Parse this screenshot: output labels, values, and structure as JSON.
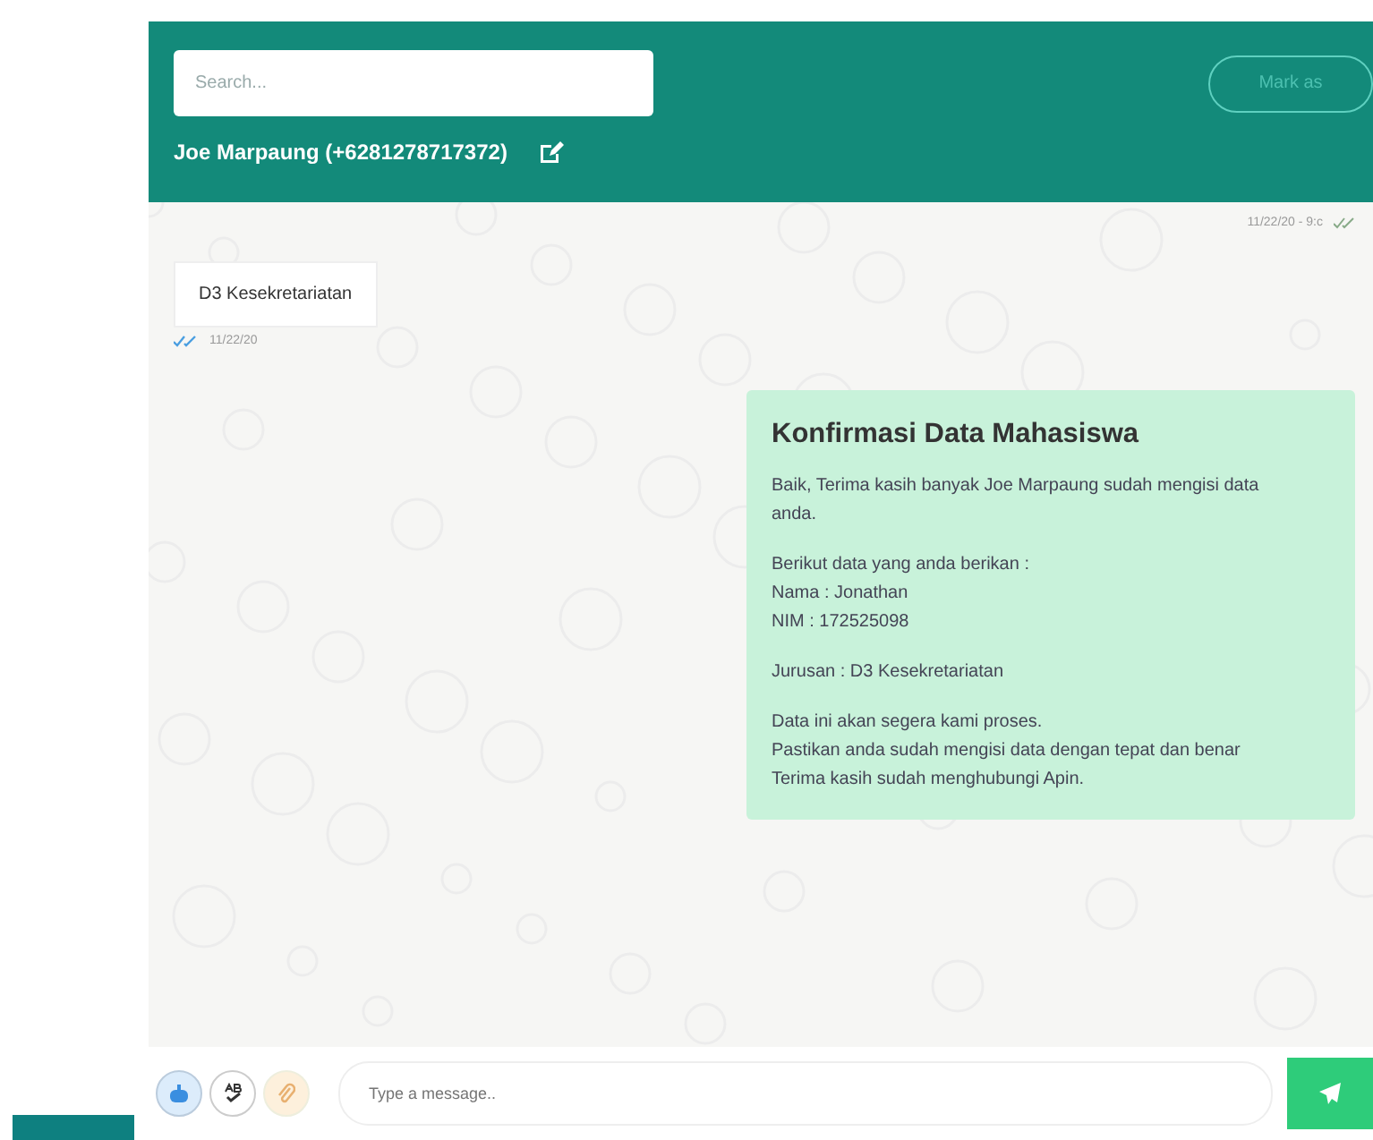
{
  "header": {
    "search": {
      "placeholder": "Search..."
    },
    "mark_button": "Mark as",
    "contact": "Joe Marpaung (+6281278717372)"
  },
  "messages": [
    {
      "kind": "meta",
      "time": "11/22/20 - 9:c",
      "read": true
    },
    {
      "kind": "incoming",
      "text": "D3 Kesekretariatan",
      "time": "11/22/20",
      "read": true
    },
    {
      "kind": "outgoing",
      "title": "Konfirmasi Data Mahasiswa",
      "paragraphs": [
        [
          "Baik, Terima kasih banyak Joe Marpaung sudah mengisi data anda."
        ],
        [
          "Berikut data yang anda berikan :",
          "Nama : Jonathan",
          "NIM : 172525098"
        ],
        [
          "Jurusan : D3 Kesekretariatan"
        ],
        [
          "Data ini akan segera kami proses.",
          "Pastikan anda sudah mengisi data dengan tepat dan benar",
          "Terima kasih sudah menghubungi Apin."
        ]
      ]
    }
  ],
  "composer": {
    "placeholder": "Type a message.."
  }
}
